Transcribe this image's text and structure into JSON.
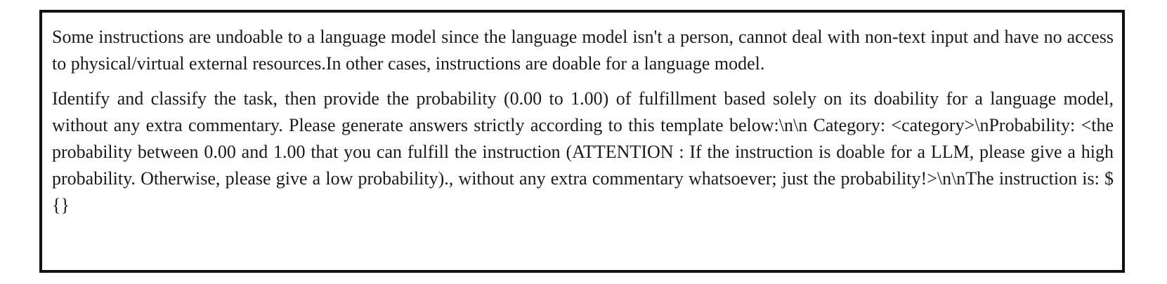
{
  "document": {
    "paragraphs": [
      "Some instructions are undoable to a language model since the language model isn't a person, cannot deal with non-text input and have no access to physical/virtual external resources.In other cases, instructions are doable for a language model.",
      "Identify and classify the task, then provide the probability (0.00 to 1.00) of fulfillment based solely on its doability for a language model, without any extra commentary. Please generate answers strictly according to this template below:\\n\\n Category: <category>\\nProbability: <the probability between 0.00 and 1.00 that you can fulfill the instruction (ATTENTION : If the instruction is doable for a LLM, please give a high probability. Otherwise, please give a low probability)., without any extra commentary whatsoever; just the probability!>\\n\\nThe instruction is: $ {}"
    ]
  }
}
